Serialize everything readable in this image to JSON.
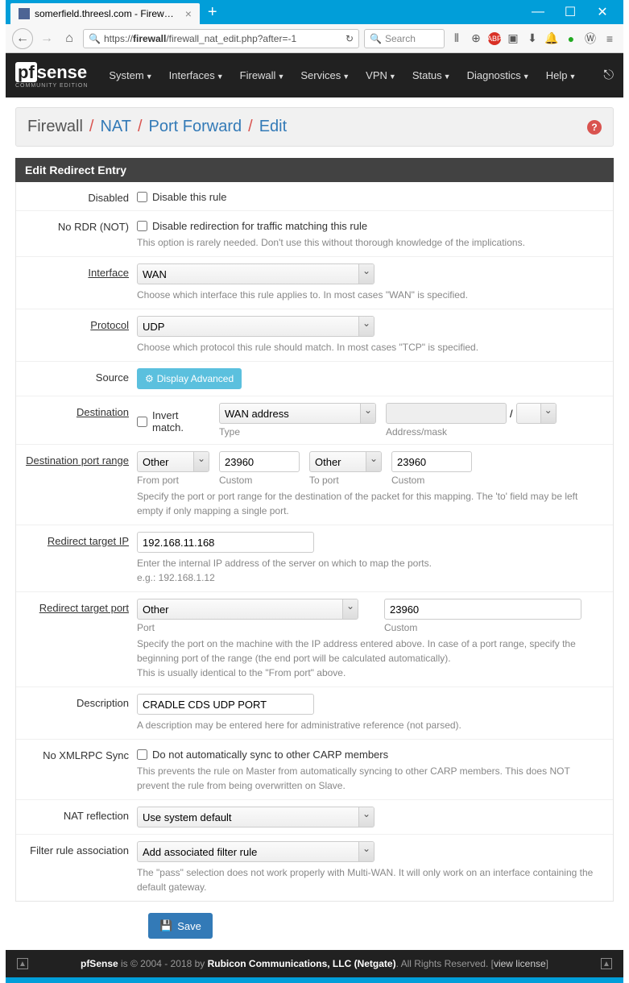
{
  "browser": {
    "tab_title": "somerfield.threesl.com - Firew…",
    "url_prefix": "https://",
    "url_host": "firewall",
    "url_path": "/firewall_nat_edit.php?after=-1",
    "search_placeholder": "Search"
  },
  "nav": {
    "items": [
      "System",
      "Interfaces",
      "Firewall",
      "Services",
      "VPN",
      "Status",
      "Diagnostics",
      "Help"
    ]
  },
  "breadcrumb": {
    "items": [
      "Firewall",
      "NAT",
      "Port Forward",
      "Edit"
    ]
  },
  "panel_title": "Edit Redirect Entry",
  "fields": {
    "disabled": {
      "label": "Disabled",
      "cb": "Disable this rule"
    },
    "nordr": {
      "label": "No RDR (NOT)",
      "cb": "Disable redirection for traffic matching this rule",
      "help": "This option is rarely needed. Don't use this without thorough knowledge of the implications."
    },
    "interface": {
      "label": "Interface",
      "value": "WAN",
      "help": "Choose which interface this rule applies to. In most cases \"WAN\" is specified."
    },
    "protocol": {
      "label": "Protocol",
      "value": "UDP",
      "help": "Choose which protocol this rule should match. In most cases \"TCP\" is specified."
    },
    "source": {
      "label": "Source",
      "btn": "Display Advanced"
    },
    "destination": {
      "label": "Destination",
      "invert": "Invert match.",
      "type_value": "WAN address",
      "type_sub": "Type",
      "mask_sep": "/",
      "mask_sub": "Address/mask"
    },
    "dest_port": {
      "label": "Destination port range",
      "from_port": "Other",
      "from_sub": "From port",
      "from_custom": "23960",
      "from_custom_sub": "Custom",
      "to_port": "Other",
      "to_sub": "To port",
      "to_custom": "23960",
      "to_custom_sub": "Custom",
      "help": "Specify the port or port range for the destination of the packet for this mapping. The 'to' field may be left empty if only mapping a single port."
    },
    "redirect_ip": {
      "label": "Redirect target IP",
      "value": "192.168.11.168",
      "help": "Enter the internal IP address of the server on which to map the ports.\ne.g.: 192.168.1.12"
    },
    "redirect_port": {
      "label": "Redirect target port",
      "port": "Other",
      "port_sub": "Port",
      "custom": "23960",
      "custom_sub": "Custom",
      "help": "Specify the port on the machine with the IP address entered above. In case of a port range, specify the beginning port of the range (the end port will be calculated automatically).\nThis is usually identical to the \"From port\" above."
    },
    "description": {
      "label": "Description",
      "value": "CRADLE CDS UDP PORT",
      "help": "A description may be entered here for administrative reference (not parsed)."
    },
    "xmlrpc": {
      "label": "No XMLRPC Sync",
      "cb": "Do not automatically sync to other CARP members",
      "help": "This prevents the rule on Master from automatically syncing to other CARP members. This does NOT prevent the rule from being overwritten on Slave."
    },
    "nat_reflection": {
      "label": "NAT reflection",
      "value": "Use system default"
    },
    "filter_rule": {
      "label": "Filter rule association",
      "value": "Add associated filter rule",
      "help": "The \"pass\" selection does not work properly with Multi-WAN. It will only work on an interface containing the default gateway."
    }
  },
  "save_btn": "Save",
  "footer": {
    "text1": "pfSense",
    "text2": " is © 2004 - 2018 by ",
    "text3": "Rubicon Communications, LLC (Netgate)",
    "text4": ". All Rights Reserved. [",
    "text5": "view license",
    "text6": "]"
  }
}
